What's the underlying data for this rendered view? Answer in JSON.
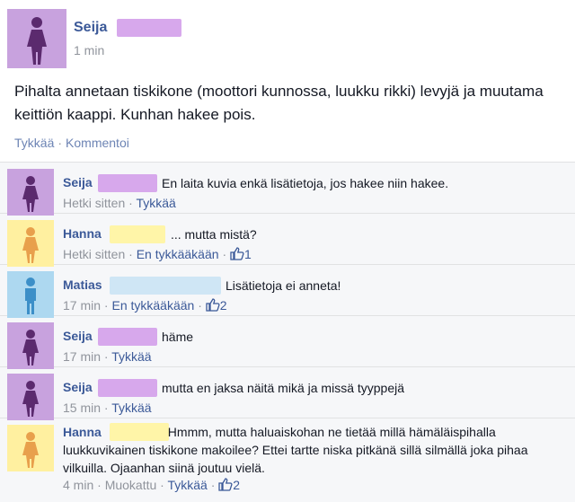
{
  "post": {
    "author": "Seija",
    "time": "1 min",
    "text": "Pihalta annetaan tiskikone (moottori kunnossa, luukku rikki) levyjä ja muutama keittiön kaappi. Kunhan hakee pois.",
    "like_label": "Tykkää",
    "separator": "·",
    "comment_label": "Kommentoi"
  },
  "colors": {
    "female_avatar_bg": "#c8a2de",
    "female_avatar_fg": "#5b2a6e",
    "hanna_avatar_bg": "#fff0a0",
    "hanna_avatar_fg": "#e8a04c",
    "male_avatar_bg": "#add8f0",
    "male_avatar_fg": "#3c8fc8",
    "purple_mask": "#d7a8ec",
    "yellow_mask": "#fff5a8",
    "blue_mask": "#cfe6f5"
  },
  "comments": [
    {
      "author": "Seija",
      "text": "En laita kuvia enkä lisätietoja, jos hakee niin hakee.",
      "time": "Hetki sitten",
      "action": "Tykkää",
      "likes": ""
    },
    {
      "author": "Hanna",
      "text": "... mutta mistä?",
      "time": "Hetki sitten",
      "action": "En tykkääkään",
      "likes": "1"
    },
    {
      "author": "Matias",
      "text": "Lisätietoja ei anneta!",
      "time": "17 min",
      "action": "En tykkääkään",
      "likes": "2"
    },
    {
      "author": "Seija",
      "text": "häme",
      "time": "17 min",
      "action": "Tykkää",
      "likes": ""
    },
    {
      "author": "Seija",
      "text": "mutta en jaksa näitä mikä ja missä tyyppejä",
      "time": "15 min",
      "action": "Tykkää",
      "likes": ""
    },
    {
      "author": "Hanna",
      "text": "Hmmm, mutta haluaiskohan ne tietää millä hämäläispihalla luukkuvikainen tiskikone makoilee? Ettei tartte niska pitkänä sillä silmällä joka pihaa vilkuilla. Ojaanhan siinä joutuu vielä.",
      "time": "4 min",
      "edited": "Muokattu",
      "action": "Tykkää",
      "likes": "2"
    }
  ],
  "sep": "·"
}
